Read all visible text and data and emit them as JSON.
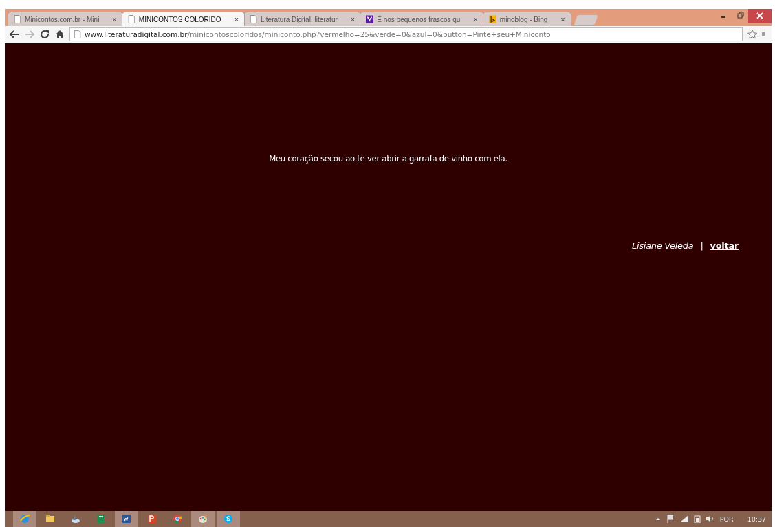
{
  "tabs": [
    {
      "title": "Minicontos.com.br - Mini",
      "kind": "page",
      "selected": false
    },
    {
      "title": "MINICONTOS COLORIDO",
      "kind": "page",
      "selected": true
    },
    {
      "title": "Literatura Digital, literatur",
      "kind": "page",
      "selected": false
    },
    {
      "title": "É nos pequenos frascos qu",
      "kind": "yahoo",
      "selected": false
    },
    {
      "title": "minoblog - Bing",
      "kind": "bing",
      "selected": false
    }
  ],
  "tab_close": "×",
  "address_bar": {
    "host": "www.literaturadigital.com.br",
    "path": "/minicontoscoloridos/miniconto.php?vermelho=25&verde=0&azul=0&button=Pinte+seu+Miniconto"
  },
  "page": {
    "story": "Meu coração secou ao te ver abrir a garrafa de vinho com ela.",
    "author": "Lisiane Veleda",
    "separator": "|",
    "back_link": "voltar"
  },
  "taskbar": {
    "apps": [
      {
        "kind": "ie",
        "running": true
      },
      {
        "kind": "folder",
        "running": false
      },
      {
        "kind": "disc",
        "running": false
      },
      {
        "kind": "calc",
        "running": false
      },
      {
        "kind": "word",
        "running": true
      },
      {
        "kind": "powerpoint",
        "running": false
      },
      {
        "kind": "chrome",
        "running": false
      },
      {
        "kind": "paint",
        "running": true
      },
      {
        "kind": "skype",
        "running": true
      }
    ],
    "language": "POR",
    "clock": "10:37"
  }
}
